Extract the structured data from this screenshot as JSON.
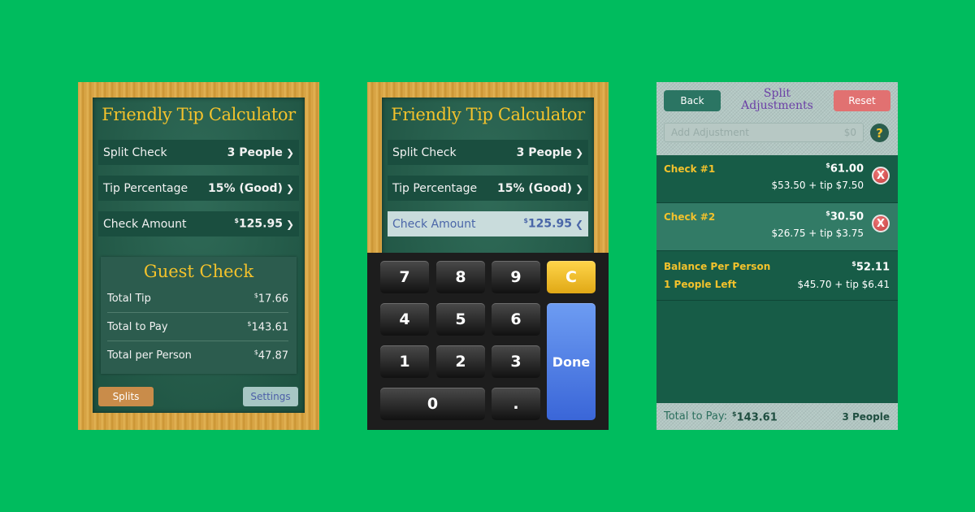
{
  "app": {
    "title": "Friendly Tip Calculator",
    "rows": {
      "split_label": "Split Check",
      "split_value": "3 People",
      "tip_label": "Tip Percentage",
      "tip_value": "15% (Good)",
      "amount_label": "Check Amount",
      "amount_value": "125.95"
    },
    "currency_symbol": "$",
    "guest_check": {
      "title": "Guest Check",
      "rows": [
        {
          "label": "Total Tip",
          "value": "17.66"
        },
        {
          "label": "Total to Pay",
          "value": "143.61"
        },
        {
          "label": "Total per Person",
          "value": "47.87"
        }
      ]
    },
    "buttons": {
      "splits": "Splits",
      "settings": "Settings"
    }
  },
  "keypad": {
    "keys": [
      "7",
      "8",
      "9",
      "4",
      "5",
      "6",
      "1",
      "2",
      "3",
      "0",
      "."
    ],
    "clear": "C",
    "done": "Done"
  },
  "split_adjustments": {
    "back": "Back",
    "reset": "Reset",
    "title_line1": "Split",
    "title_line2": "Adjustments",
    "input_placeholder": "Add Adjustment",
    "input_suffix": "$0",
    "help": "?",
    "checks": [
      {
        "name": "Check #1",
        "amount": "61.00",
        "breakdown": "$53.50 + tip $7.50"
      },
      {
        "name": "Check #2",
        "amount": "30.50",
        "breakdown": "$26.75 + tip $3.75"
      }
    ],
    "remove_symbol": "X",
    "balance": {
      "label": "Balance Per Person",
      "amount": "52.11",
      "people_left": "1 People Left",
      "breakdown": "$45.70 + tip $6.41"
    },
    "footer": {
      "label": "Total to Pay:",
      "total": "143.61",
      "people": "3 People"
    }
  },
  "colors": {
    "background": "#00bc5e",
    "chalk_yellow": "#f3c22c",
    "board_green": "#1d5140",
    "done_blue": "#3a66d8",
    "clear_yellow": "#e0a816",
    "reset_red": "#e17171"
  }
}
